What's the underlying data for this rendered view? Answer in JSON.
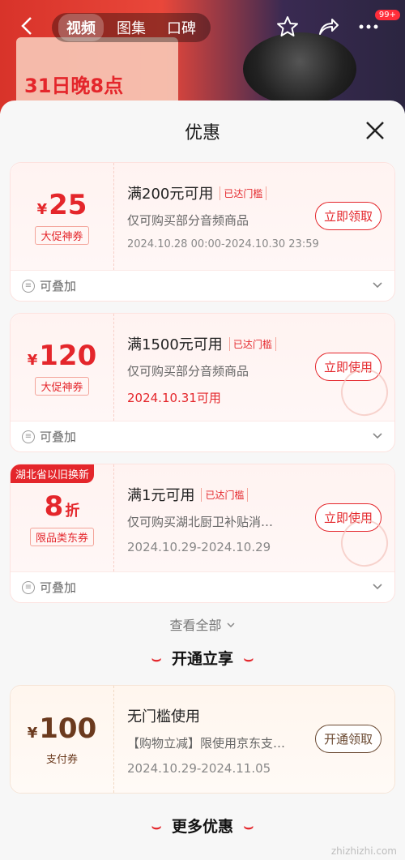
{
  "top_bar": {
    "tabs": [
      "视频",
      "图集",
      "口碑"
    ],
    "active_tab_index": 0,
    "badge": "99+",
    "promo_text": "31日晚8点"
  },
  "sheet": {
    "title": "优惠",
    "coupons": [
      {
        "currency": "¥",
        "amount": "25",
        "unit": "",
        "tag": "大促神券",
        "condition": "满200元可用",
        "status_tag": "已达门槛",
        "scope": "仅可购买部分音频商品",
        "validity": "2024.10.28 00:00-2024.10.30 23:59",
        "action": "立即领取",
        "footer": "可叠加"
      },
      {
        "currency": "¥",
        "amount": "120",
        "unit": "",
        "tag": "大促神券",
        "condition": "满1500元可用",
        "status_tag": "已达门槛",
        "scope": "仅可购买部分音频商品",
        "validity": "2024.10.31可用",
        "action": "立即使用",
        "footer": "可叠加"
      },
      {
        "corner_tag": "湖北省以旧换新",
        "currency": "",
        "amount": "8",
        "unit": "折",
        "tag": "限品类东券",
        "condition": "满1元可用",
        "status_tag": "已达门槛",
        "scope": "仅可购买湖北厨卫补贴消…",
        "validity": "2024.10.29-2024.10.29",
        "action": "立即使用",
        "footer": "可叠加"
      }
    ],
    "see_all": "查看全部",
    "section_open": "开通立享",
    "open_coupon": {
      "currency": "¥",
      "amount": "100",
      "tag": "支付券",
      "condition": "无门槛使用",
      "scope": "【购物立减】限使用京东支…",
      "validity": "2024.10.29-2024.11.05",
      "action": "开通领取"
    },
    "section_more": "更多优惠"
  },
  "watermark": "zhizhizhi.com",
  "colors": {
    "accent": "#e4262b",
    "bg": "#f7f7f7"
  }
}
